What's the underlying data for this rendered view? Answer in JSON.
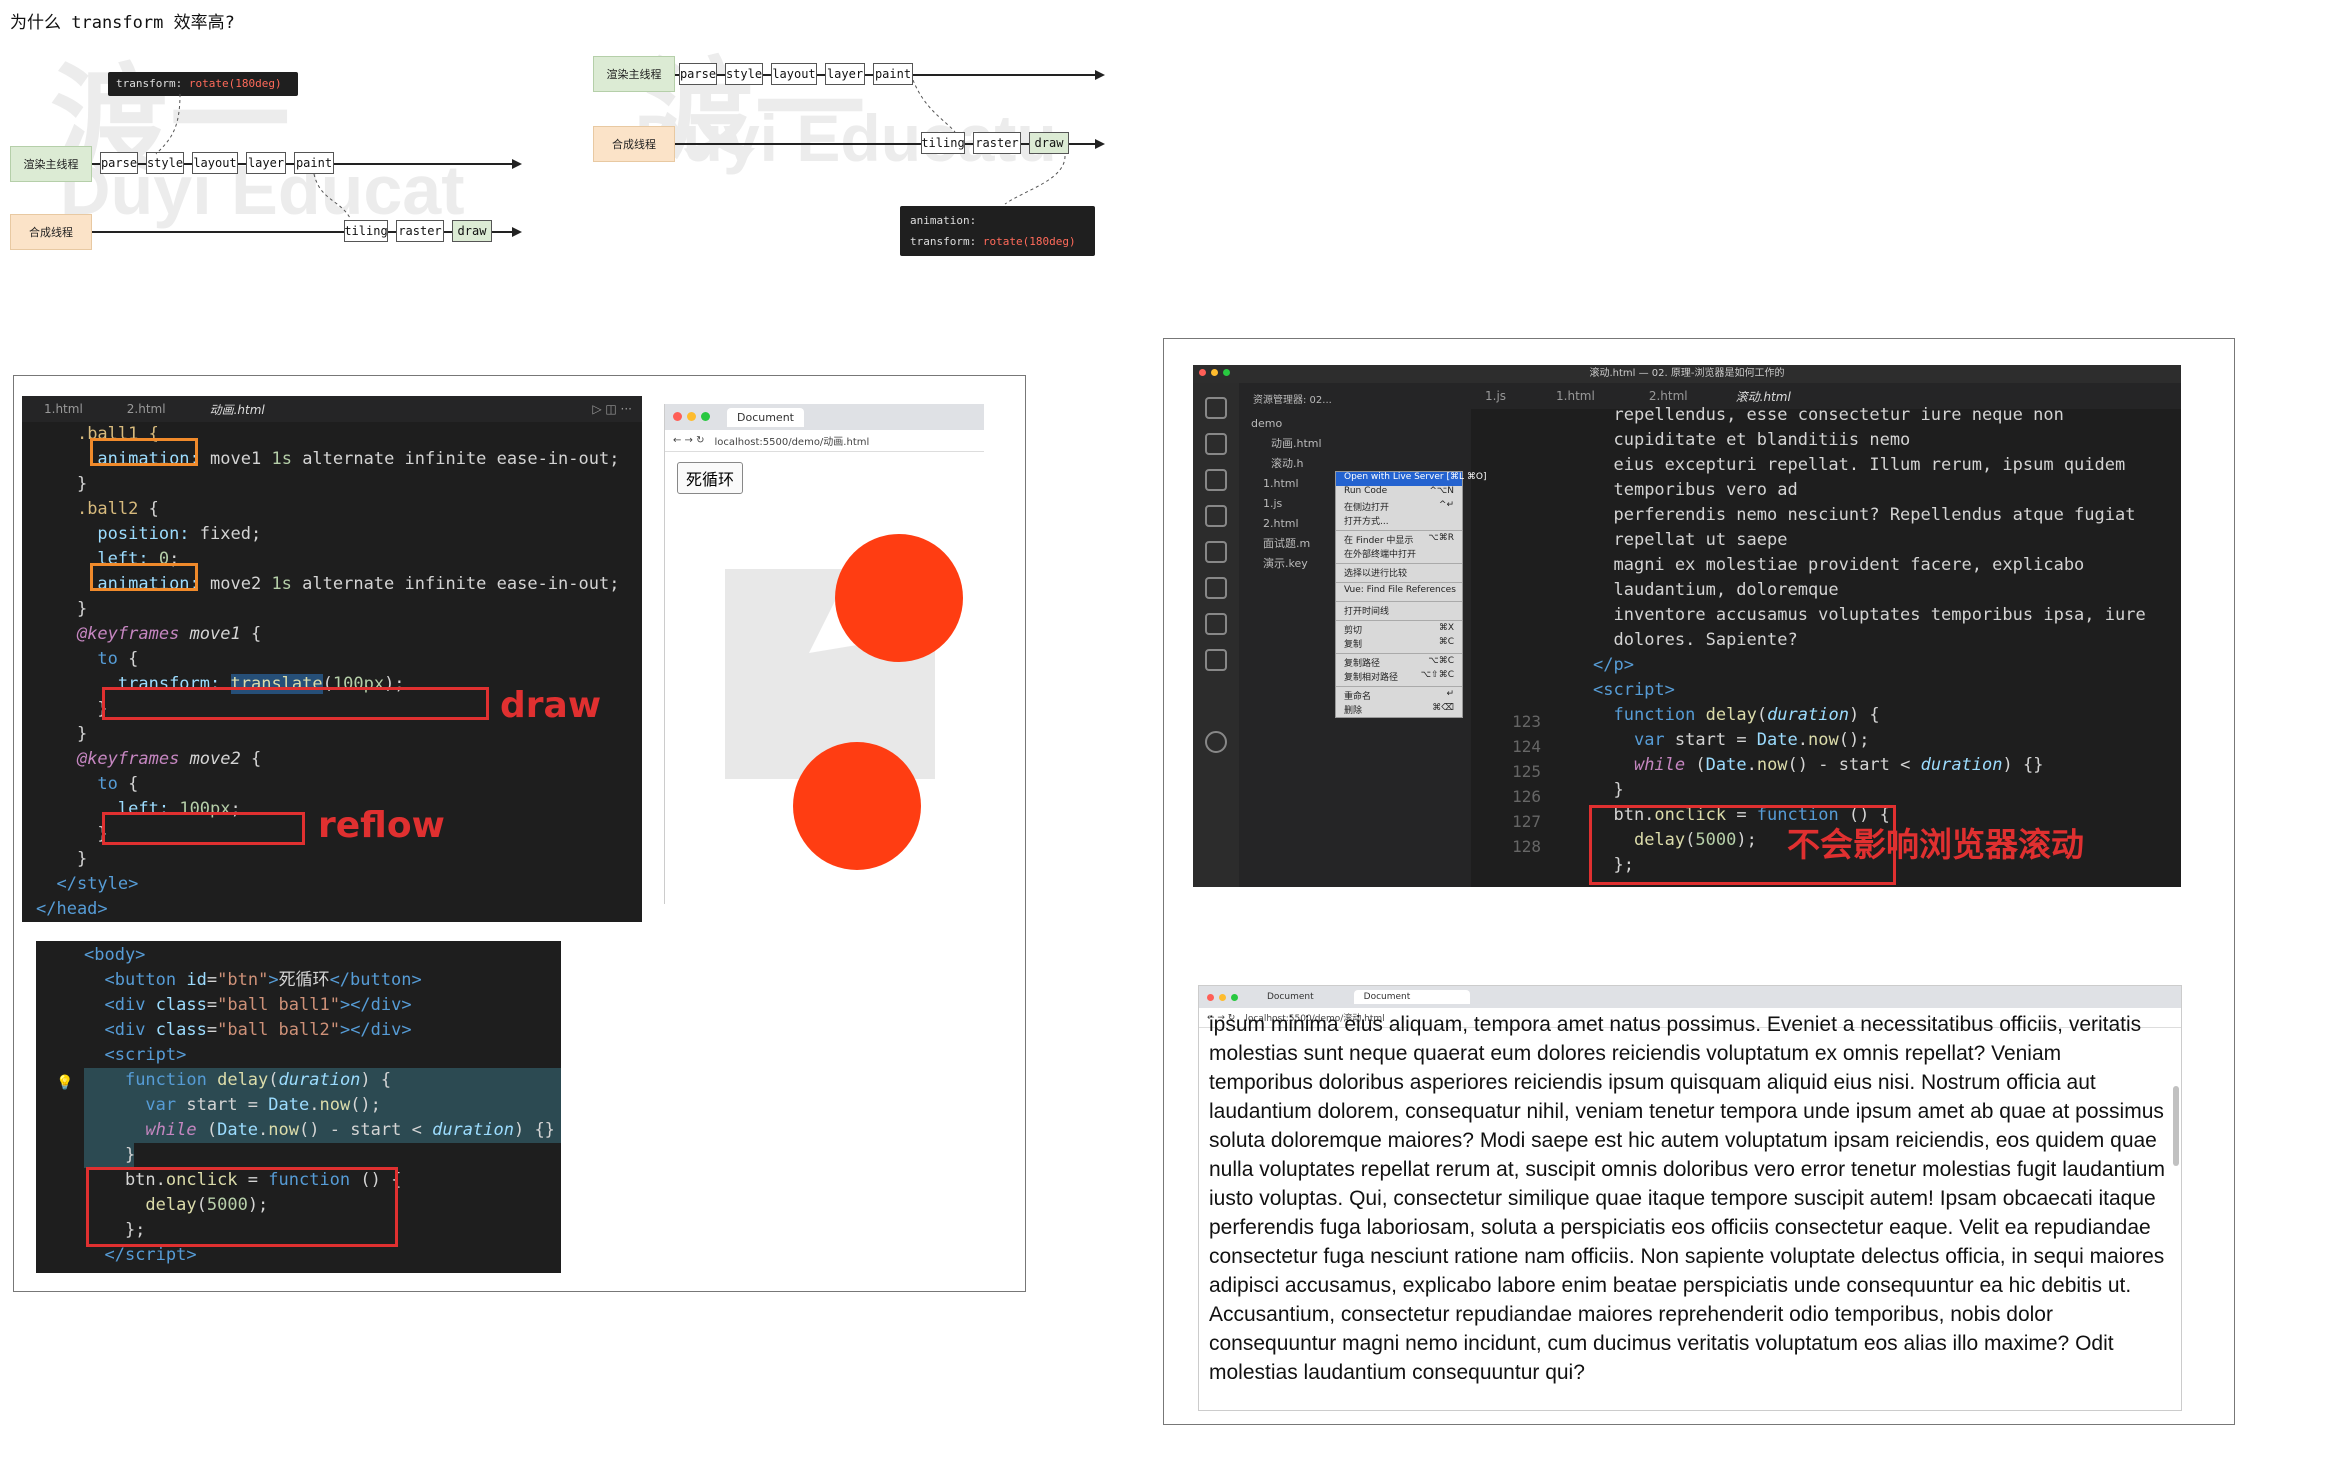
{
  "page": {
    "title": "为什么 transform 效率高?"
  },
  "watermark": {
    "cn": "渡一",
    "en": "Duyi Educat",
    "en2": "Duyi Educatu",
    "en_full": "Education"
  },
  "diagram1": {
    "lanes": {
      "render": "渲染主线程",
      "compose": "合成线程"
    },
    "tooltip": {
      "key": "transform:",
      "value": "rotate(180deg)"
    },
    "main_steps": [
      "parse",
      "style",
      "layout",
      "layer",
      "paint"
    ],
    "compose_steps": [
      "tiling",
      "raster",
      "draw"
    ]
  },
  "diagram2": {
    "lanes": {
      "render": "渲染主线程",
      "compose": "合成线程"
    },
    "tooltip": {
      "line1": "animation:",
      "key": "transform:",
      "value": "rotate(180deg)"
    },
    "main_steps": [
      "parse",
      "style",
      "layout",
      "layer",
      "paint"
    ],
    "compose_steps": [
      "tiling",
      "raster",
      "draw"
    ]
  },
  "editor1": {
    "tabs": [
      "1.html",
      "2.html",
      "动画.html"
    ],
    "labels": {
      "draw": "draw",
      "reflow": "reflow"
    }
  },
  "browser1": {
    "tab_title": "Document",
    "url": "localhost:5500/demo/动画.html",
    "button": "死循环",
    "ball_color": "#ff3d12"
  },
  "editor3": {
    "title": "滚动.html — 02. 原理-浏览器是如何工作的",
    "explorer_title": "资源管理器: 02...",
    "tabs": [
      "1.js",
      "1.html",
      "2.html",
      "滚动.html"
    ],
    "tree": [
      "demo",
      "动画.html",
      "滚动.h",
      "1.html",
      "1.js",
      "2.html",
      "面试题.m",
      "演示.key"
    ],
    "line_numbers": [
      "123",
      "124",
      "125",
      "126",
      "127",
      "128"
    ],
    "text_lines": [
      "repellendus, esse consectetur iure neque non",
      "cupiditate et blanditiis nemo",
      "eius excepturi repellat. Illum rerum, ipsum quidem",
      "temporibus vero ad",
      "perferendis nemo nesciunt? Repellendus atque fugiat",
      "repellat ut saepe",
      "magni ex molestiae provident facere, explicabo",
      "laudantium, doloremque",
      "inventore accusamus voluptates temporibus ipsa, iure",
      "dolores. Sapiente?"
    ],
    "label": "不会影响浏览器滚动",
    "menu": [
      {
        "label": "Open with Live Server [⌘L ⌘O]",
        "key": "",
        "hl": true
      },
      {
        "label": "Run Code",
        "key": "^⌥N"
      },
      {
        "label": "在侧边打开",
        "key": "^↵"
      },
      {
        "label": "打开方式...",
        "key": ""
      },
      {
        "sep": true
      },
      {
        "label": "在 Finder 中显示",
        "key": "⌥⌘R"
      },
      {
        "label": "在外部终端中打开",
        "key": ""
      },
      {
        "sep": true
      },
      {
        "label": "选择以进行比较",
        "key": ""
      },
      {
        "sep": true
      },
      {
        "label": "Vue: Find File References",
        "key": ""
      },
      {
        "sep": true
      },
      {
        "label": "打开时间线",
        "key": ""
      },
      {
        "sep": true
      },
      {
        "label": "剪切",
        "key": "⌘X"
      },
      {
        "label": "复制",
        "key": "⌘C"
      },
      {
        "sep": true
      },
      {
        "label": "复制路径",
        "key": "⌥⌘C"
      },
      {
        "label": "复制相对路径",
        "key": "⌥⇧⌘C"
      },
      {
        "sep": true
      },
      {
        "label": "重命名",
        "key": "↵"
      },
      {
        "label": "删除",
        "key": "⌘⌫"
      }
    ]
  },
  "browser2": {
    "tabs": [
      "Document",
      "Document"
    ],
    "url": "localhost:5500/demo/滚动.html",
    "text": "ipsum minima eius aliquam, tempora amet natus possimus. Eveniet a necessitatibus officiis, veritatis molestias sunt neque quaerat eum dolores reiciendis voluptatum ex omnis repellat? Veniam temporibus doloribus asperiores reiciendis ipsum quisquam aliquid eius nisi. Nostrum officia aut laudantium dolorem, consequatur nihil, veniam tenetur tempora unde ipsum amet ab quae at possimus soluta doloremque maiores? Modi saepe est hic autem voluptatum ipsam reiciendis, eos quidem quae nulla voluptates repellat rerum at, suscipit omnis doloribus vero error tenetur molestias fugit laudantium iusto voluptas. Qui, consectetur similique quae itaque tempore suscipit autem! Ipsam obcaecati itaque perferendis fuga laboriosam, soluta a perspiciatis eos officiis consectetur eaque. Velit ea repudiandae consectetur fuga nesciunt ratione nam officiis. Non sapiente voluptate delectus officia, in sequi maiores adipisci accusamus, explicabo labore enim beatae perspiciatis unde consequuntur ea hic debitis ut. Accusantium, consectetur repudiandae maiores reprehenderit odio temporibus, nobis dolor consequuntur magni nemo incidunt, cum ducimus veritatis voluptatum eos alias illo maxime? Odit molestias laudantium consequuntur qui?"
  },
  "colors": {
    "accent_red": "#e03030",
    "accent_orange": "#f08a2b",
    "lane_green": "#dcebd4",
    "lane_orange": "#fbe3c8"
  }
}
